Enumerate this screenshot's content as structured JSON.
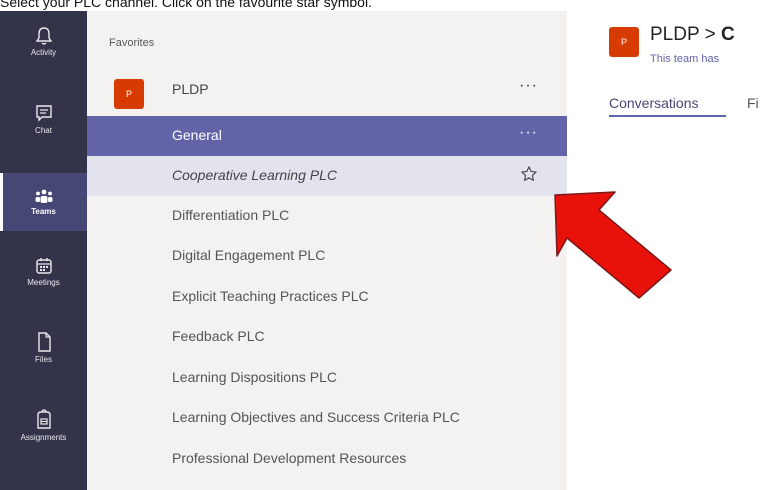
{
  "caption": "Select your PLC channel. Click on the favourite star symbol.",
  "rail": {
    "items": [
      {
        "label": "Activity",
        "icon": "bell-icon"
      },
      {
        "label": "Chat",
        "icon": "chat-icon"
      },
      {
        "label": "Teams",
        "icon": "teams-icon",
        "active": true
      },
      {
        "label": "Meetings",
        "icon": "calendar-icon"
      },
      {
        "label": "Files",
        "icon": "file-icon"
      },
      {
        "label": "Assignments",
        "icon": "assignments-icon"
      }
    ]
  },
  "panel": {
    "favorites_label": "Favorites",
    "team": {
      "avatar_letter": "P",
      "name": "PLDP",
      "more": "···"
    },
    "channels": [
      {
        "label": "General",
        "state": "selected"
      },
      {
        "label": "Cooperative Learning PLC",
        "state": "hovered"
      },
      {
        "label": "Differentiation PLC"
      },
      {
        "label": "Digital Engagement PLC"
      },
      {
        "label": "Explicit Teaching Practices PLC"
      },
      {
        "label": "Feedback PLC"
      },
      {
        "label": "Learning Dispositions PLC"
      },
      {
        "label": "Learning Objectives and Success Criteria PLC"
      },
      {
        "label": "Professional Development Resources"
      }
    ],
    "selected_more": "···"
  },
  "right": {
    "avatar_letter": "P",
    "title_team": "PLDP",
    "title_sep": " > ",
    "title_rest": "C",
    "subtitle": "This team has",
    "tabs": [
      "Conversations",
      "Fi"
    ]
  },
  "colors": {
    "rail_bg": "#33344a",
    "accent": "#6264a7",
    "avatar": "#d83b01",
    "arrow": "#e8120b"
  }
}
